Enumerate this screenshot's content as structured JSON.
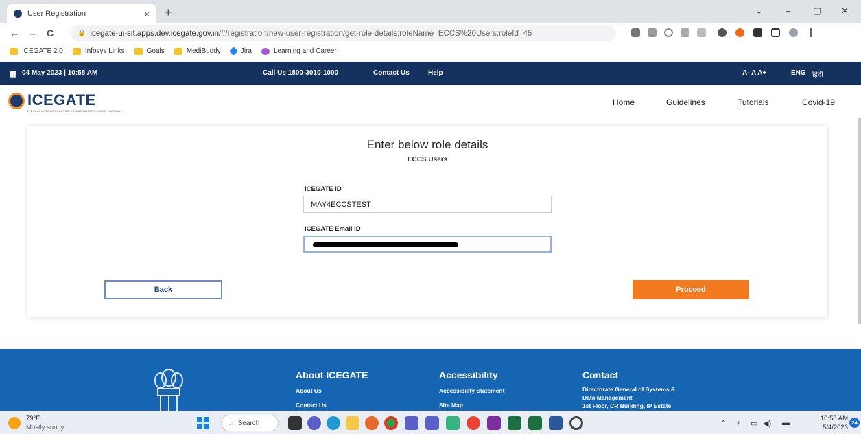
{
  "browser": {
    "tab_title": "User Registration",
    "tab_close": "×",
    "new_tab": "+",
    "url_host": "icegate-ui-sit.apps.dev.icegate.gov.in",
    "url_path": "/#/registration/new-user-registration/get-role-details;roleName=ECCS%20Users;roleId=45",
    "window_controls": [
      "⌄",
      "–",
      "▢",
      "✕"
    ],
    "nav": {
      "back": "←",
      "forward": "→",
      "reload": "C"
    },
    "bookmarks": [
      "ICEGATE 2.0",
      "Infosys Links",
      "Goals",
      "MediBuddy",
      "Jira",
      "Learning and Career"
    ]
  },
  "topbar": {
    "datetime": "04 May 2023 | 10:58 AM",
    "call_label": "Call Us  1800-3010-1000",
    "contact": "Contact Us",
    "help": "Help",
    "font_sizes": "A-  A  A+",
    "lang_en": "ENG",
    "lang_hi": "हिंदी"
  },
  "header": {
    "logo_text": "ICEGATE",
    "logo_sub": "INDIAN CUSTOMS ELECTRONIC DATA INTERCHANGE GATEWAY",
    "nav": [
      "Home",
      "Guidelines",
      "Tutorials",
      "Covid-19"
    ]
  },
  "form": {
    "title": "Enter below role details",
    "subtitle": "ECCS Users",
    "icegate_id_label": "ICEGATE ID",
    "icegate_id_value": "MAY4ECCSTEST",
    "email_label": "ICEGATE Email ID",
    "back_label": "Back",
    "proceed_label": "Proceed"
  },
  "footer": {
    "about_heading": "About ICEGATE",
    "about_links": [
      "About Us",
      "Contact Us"
    ],
    "access_heading": "Accessibility",
    "access_links": [
      "Accessibility Statement",
      "Site Map"
    ],
    "contact_heading": "Contact",
    "contact_lines": [
      "Directorate General of Systems &",
      "Data Management",
      "1st Floor, CR Building, IP Estate"
    ]
  },
  "taskbar": {
    "temp": "79°F",
    "condition": "Mostly sunny",
    "search": "Search",
    "time": "10:58 AM",
    "date": "5/4/2023",
    "badge": "24"
  },
  "colors": {
    "topbar": "#15325f",
    "footer": "#1565b3",
    "proceed": "#f47a1f",
    "brand": "#1d3b6b"
  }
}
